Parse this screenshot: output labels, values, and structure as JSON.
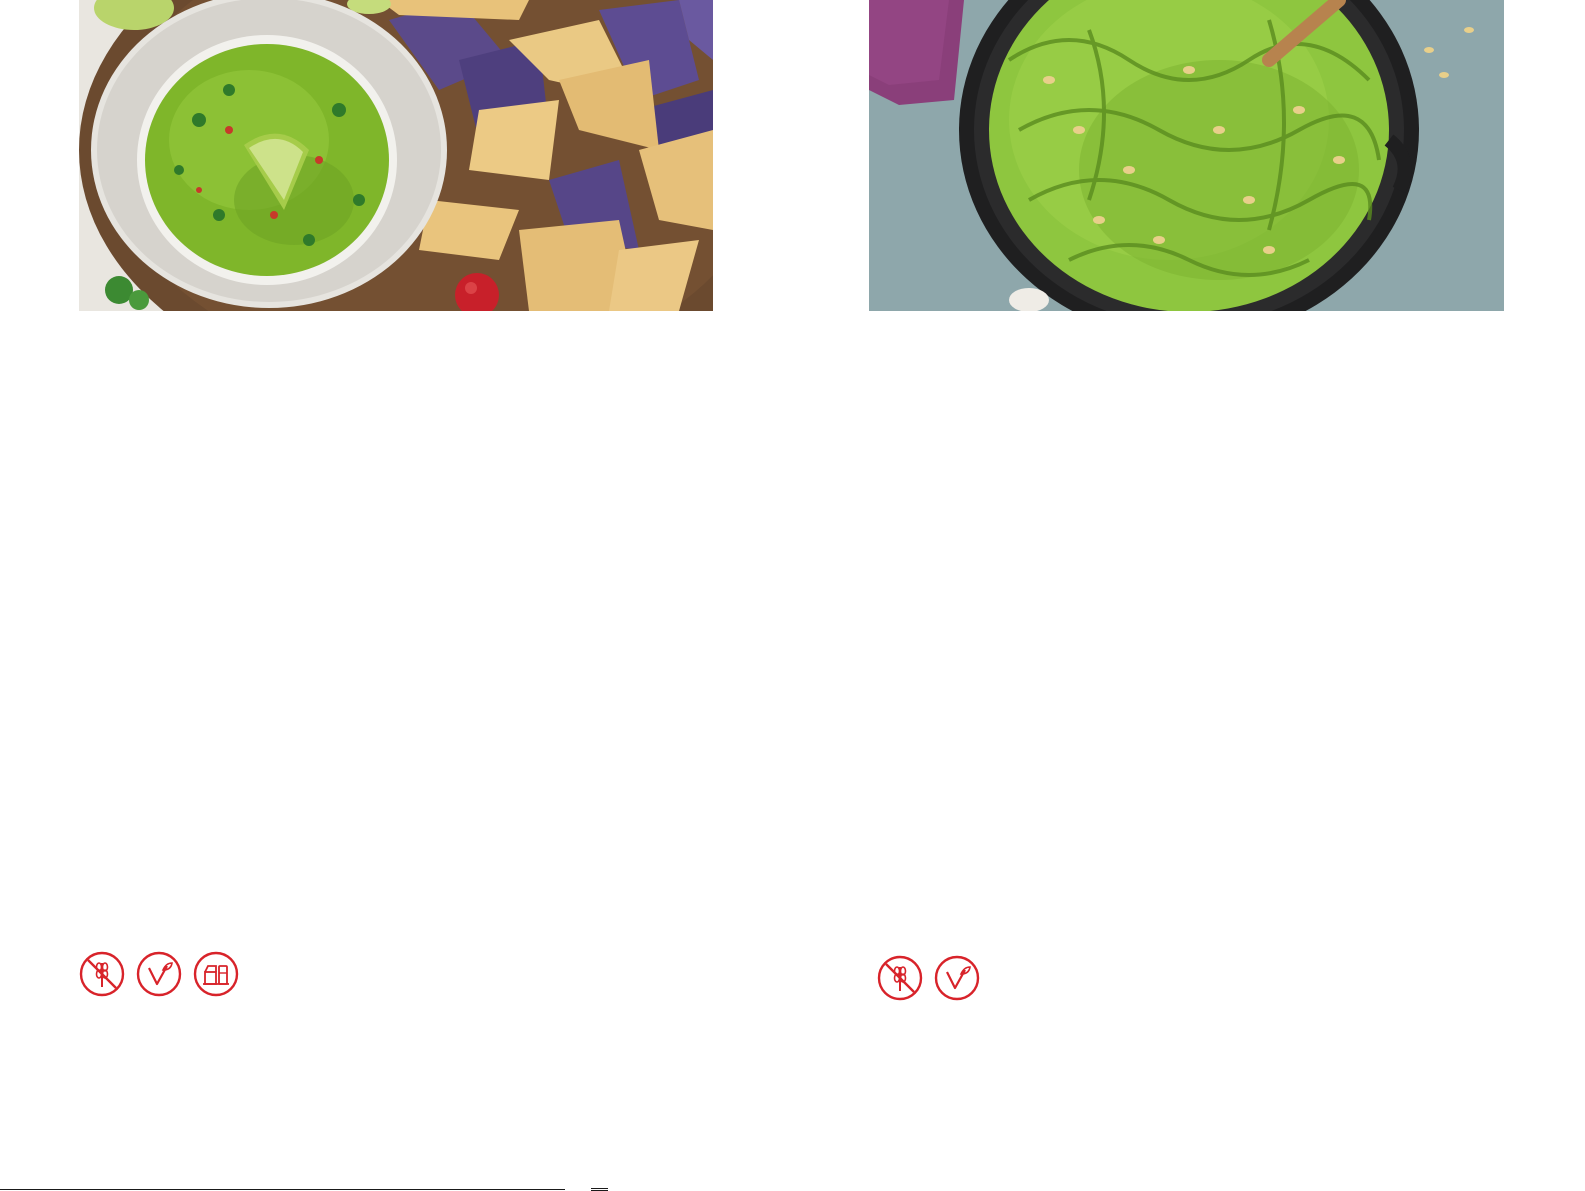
{
  "pages": {
    "left": {
      "photo": {
        "subject": "guacamole-with-tortilla-chips"
      },
      "diet_icons": [
        "gluten-free-icon",
        "vegan-icon",
        "dairy-free-icon"
      ]
    },
    "right": {
      "photo": {
        "subject": "pesto-fettuccine-in-skillet"
      },
      "diet_icons": [
        "gluten-free-icon",
        "vegan-icon"
      ]
    }
  },
  "colors": {
    "icon_red": "#d8232a",
    "guacamole_green": "#7fb62a",
    "pesto_green": "#8ec63f",
    "board_brown": "#6b4a2f",
    "slate_blue": "#8aa3a8"
  }
}
